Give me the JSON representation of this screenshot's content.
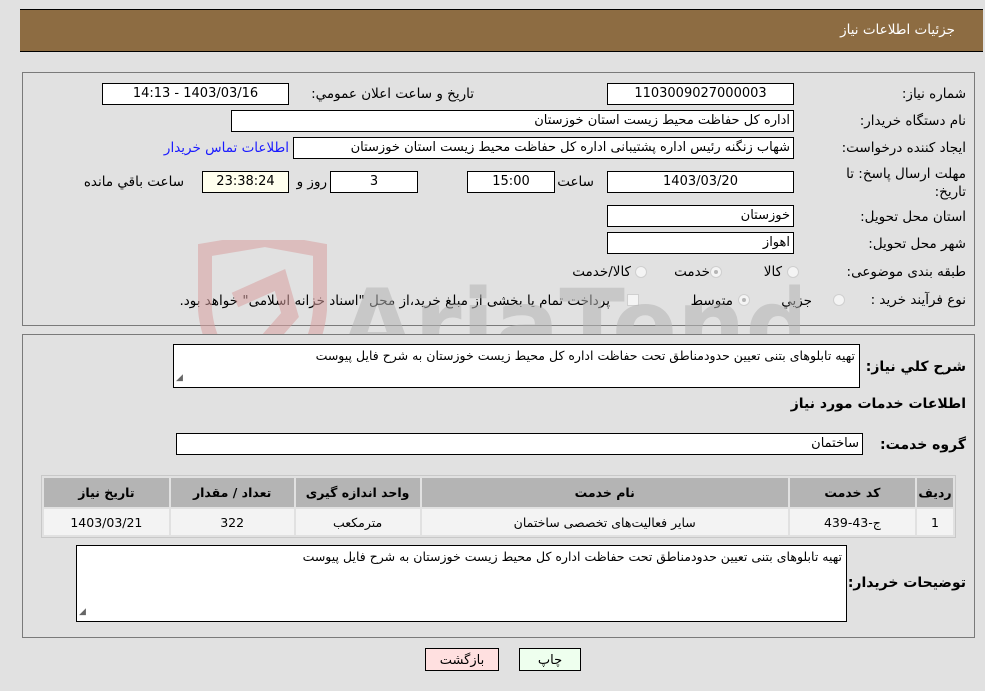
{
  "header": {
    "title": "جزئیات اطلاعات نیاز"
  },
  "details": {
    "need_number": {
      "label": "شماره نیاز:",
      "value": "1103009027000003"
    },
    "announce_datetime": {
      "label": "تاريخ و ساعت اعلان عمومي:",
      "value": "1403/03/16 - 14:13"
    },
    "buyer_org": {
      "label": "نام دستگاه خريدار:",
      "value": "اداره کل حفاظت محیط زیست استان خوزستان"
    },
    "requester": {
      "label": "ايجاد کننده درخواست:",
      "value": "شهاب زنگنه رئیس اداره پشتیبانی اداره کل حفاظت محیط زیست استان خوزستان",
      "contact_link": "اطلاعات تماس خريدار"
    },
    "deadline": {
      "label": "مهلت ارسال پاسخ: تا تاریخ:",
      "date": "1403/03/20",
      "time_label": "ساعت",
      "time": "15:00",
      "days": "3",
      "days_label": "روز و",
      "remaining": "23:38:24",
      "remaining_label": "ساعت باقي مانده"
    },
    "province": {
      "label": "استان محل تحویل:",
      "value": "خوزستان"
    },
    "city": {
      "label": "شهر محل تحویل:",
      "value": "اهواز"
    },
    "category": {
      "label": "طبقه بندی موضوعی:",
      "options": [
        "کالا",
        "خدمت",
        "کالا/خدمت"
      ],
      "selected": "خدمت"
    },
    "purchase_type": {
      "label": "نوع فرآیند خرید :",
      "options": [
        "جزيي",
        "متوسط"
      ],
      "selected": "متوسط",
      "treasury_note": "پرداخت تمام یا بخشی از مبلغ خرید،از محل \"اسناد خزانه اسلامی\" خواهد بود.",
      "treasury_checked": false
    }
  },
  "description": {
    "label": "شرح کلي نياز:",
    "value": "تهیه تابلوهای بتنی تعیین حدودمناطق تحت حفاظت اداره کل محیط زیست خوزستان به شرح فایل پیوست"
  },
  "services": {
    "section_title": "اطلاعات خدمات مورد نياز",
    "group_label": "گروه خدمت:",
    "group_value": "ساختمان",
    "table": {
      "headers": [
        "رديف",
        "کد خدمت",
        "نام خدمت",
        "واحد اندازه گیری",
        "تعداد / مقدار",
        "تاريخ نياز"
      ],
      "rows": [
        [
          "1",
          "ج-43-439",
          "سایر فعالیت‌های تخصصی ساختمان",
          "مترمکعب",
          "322",
          "1403/03/21"
        ]
      ]
    }
  },
  "buyer_notes": {
    "label": "توضيحات خريدار:",
    "value": "تهیه تابلوهای بتنی تعیین حدودمناطق تحت حفاظت اداره کل محیط زیست خوزستان به شرح فایل پیوست"
  },
  "buttons": {
    "print": "چاپ",
    "back": "بازگشت"
  },
  "watermark": {
    "text": "AriaTender.neT"
  },
  "colors": {
    "header_bg": "#8d6c42",
    "link": "#1a1aff",
    "back_bg": "#ffe0e0",
    "print_bg": "#eeffee",
    "remaining_bg": "#ffffee"
  }
}
